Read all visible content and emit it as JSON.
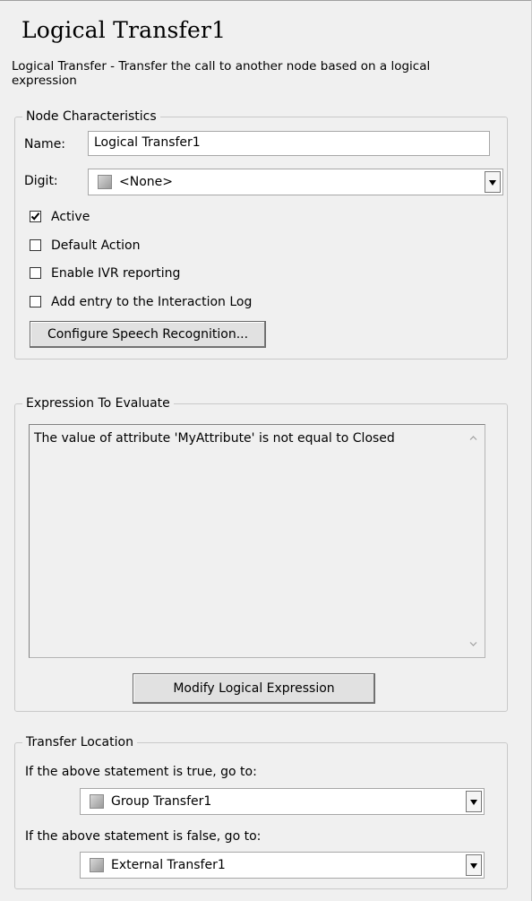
{
  "header": {
    "title": "Logical Transfer1",
    "description": "Logical Transfer - Transfer the call to another node based on a logical expression"
  },
  "node_characteristics": {
    "legend": "Node Characteristics",
    "name_label": "Name:",
    "name_value": "Logical Transfer1",
    "digit_label": "Digit:",
    "digit_value": "<None>",
    "checkboxes": [
      {
        "label": "Active",
        "checked": true
      },
      {
        "label": "Default Action",
        "checked": false
      },
      {
        "label": "Enable IVR reporting",
        "checked": false
      },
      {
        "label": "Add entry to the Interaction Log",
        "checked": false
      }
    ],
    "configure_button": "Configure Speech Recognition..."
  },
  "expression": {
    "legend": "Expression To Evaluate",
    "text": "The value of attribute 'MyAttribute' is not equal to Closed",
    "modify_button": "Modify Logical Expression"
  },
  "transfer_location": {
    "legend": "Transfer Location",
    "true_label": "If the above statement is true, go to:",
    "true_value": "Group Transfer1",
    "false_label": "If the above statement is false, go to:",
    "false_value": "External Transfer1"
  },
  "icons": {
    "node": "node-swatch-icon",
    "dropdown": "dropdown-arrow-icon",
    "check": "checkmark-icon"
  }
}
